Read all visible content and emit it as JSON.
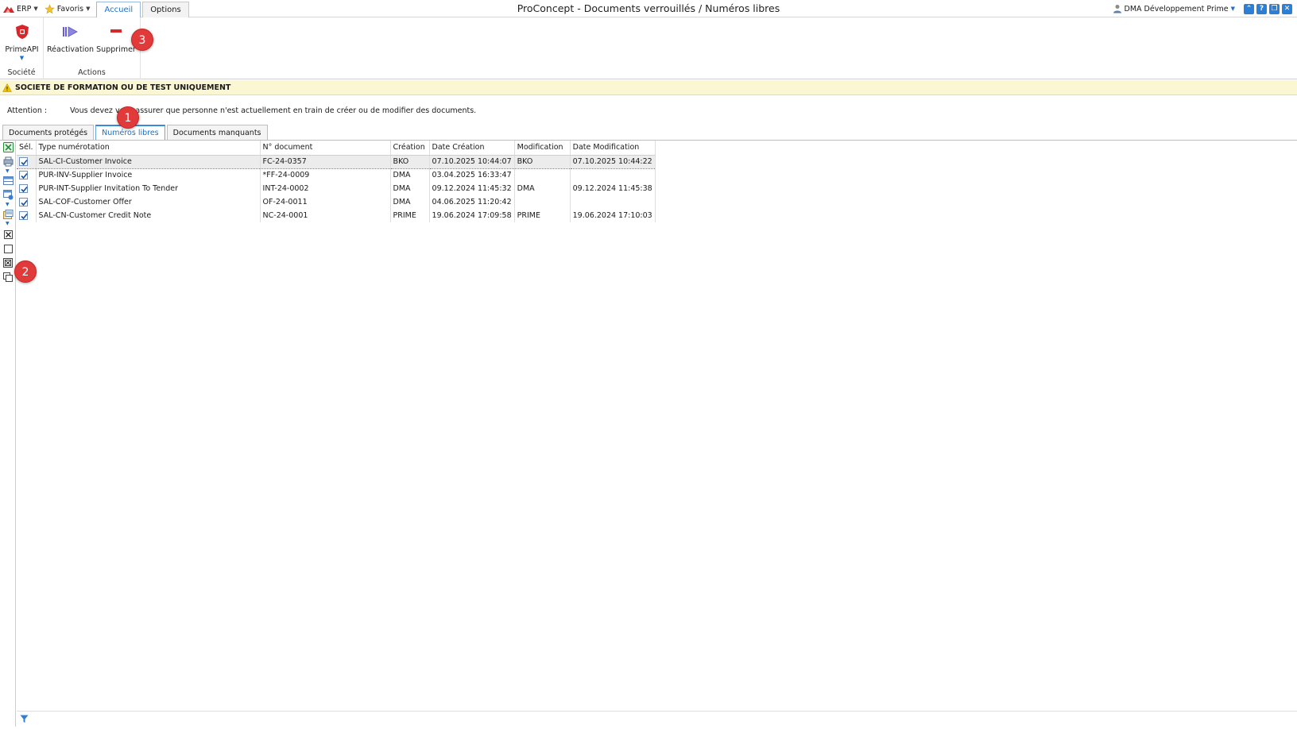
{
  "topbar": {
    "erp_label": "ERP",
    "favoris_label": "Favoris",
    "tabs": [
      {
        "label": "Accueil"
      },
      {
        "label": "Options"
      }
    ],
    "window_title": "ProConcept - Documents verrouillés / Numéros libres",
    "user_label": "DMA Développement Prime"
  },
  "ribbon": {
    "groups": [
      {
        "label": "Société",
        "buttons": [
          {
            "label": "PrimeAPI"
          }
        ]
      },
      {
        "label": "Actions",
        "buttons": [
          {
            "label": "Réactivation"
          },
          {
            "label": "Supprimer"
          }
        ]
      }
    ]
  },
  "banner": {
    "text": "SOCIETE DE FORMATION OU DE TEST UNIQUEMENT"
  },
  "attention": {
    "label": "Attention :",
    "message": "Vous devez vous assurer que personne n'est actuellement en train de créer ou de modifier des documents."
  },
  "tabs": [
    {
      "label": "Documents protégés"
    },
    {
      "label": "Numéros libres"
    },
    {
      "label": "Documents manquants"
    }
  ],
  "grid": {
    "columns": [
      "Sél.",
      "Type numérotation",
      "N° document",
      "Création",
      "Date Création",
      "Modification",
      "Date Modification"
    ],
    "rows": [
      {
        "checked": true,
        "type": "SAL-CI-Customer Invoice",
        "doc": "FC-24-0357",
        "creation": "BKO",
        "date_creation": "07.10.2025 10:44:07",
        "modification": "BKO",
        "date_modification": "07.10.2025 10:44:22"
      },
      {
        "checked": true,
        "type": "PUR-INV-Supplier Invoice",
        "doc": "*FF-24-0009",
        "creation": "DMA",
        "date_creation": "03.04.2025 16:33:47",
        "modification": "",
        "date_modification": ""
      },
      {
        "checked": true,
        "type": "PUR-INT-Supplier Invitation To Tender",
        "doc": "INT-24-0002",
        "creation": "DMA",
        "date_creation": "09.12.2024 11:45:32",
        "modification": "DMA",
        "date_modification": "09.12.2024 11:45:38"
      },
      {
        "checked": true,
        "type": "SAL-COF-Customer Offer",
        "doc": "OF-24-0011",
        "creation": "DMA",
        "date_creation": "04.06.2025 11:20:42",
        "modification": "",
        "date_modification": ""
      },
      {
        "checked": true,
        "type": "SAL-CN-Customer Credit Note",
        "doc": "NC-24-0001",
        "creation": "PRIME",
        "date_creation": "19.06.2024 17:09:58",
        "modification": "PRIME",
        "date_modification": "19.06.2024 17:10:03"
      }
    ]
  },
  "callouts": [
    "1",
    "2",
    "3"
  ]
}
